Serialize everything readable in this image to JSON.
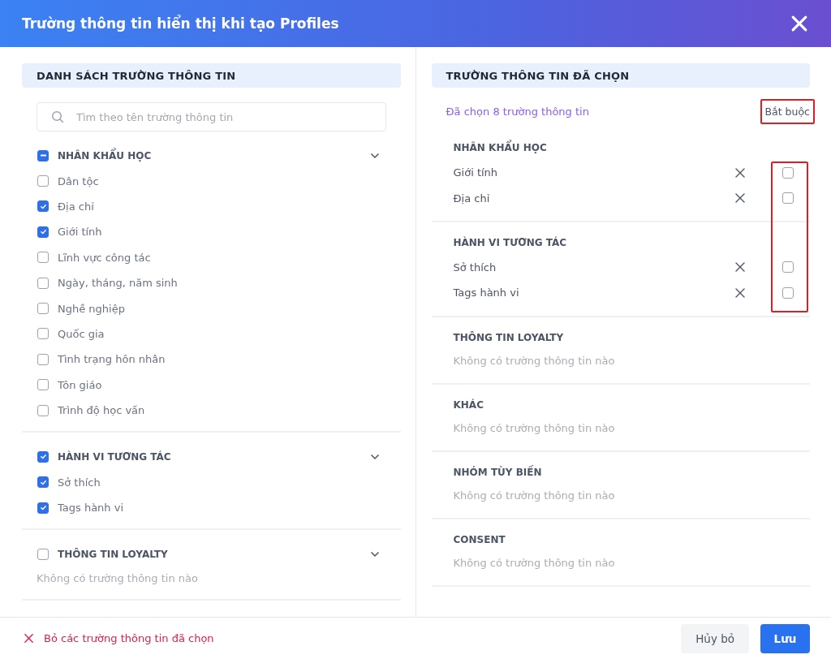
{
  "dialog": {
    "title": "Trường thông tin hiển thị khi tạo Profiles"
  },
  "field_list": {
    "title": "DANH SÁCH TRƯỜNG THÔNG TIN",
    "search": {
      "placeholder": "Tìm theo tên trường thông tin"
    },
    "groups": [
      {
        "name": "NHÂN KHẨU HỌC",
        "kind": "partial",
        "fields": [
          {
            "label": "Dân tộc",
            "checked": false
          },
          {
            "label": "Địa chỉ",
            "checked": true
          },
          {
            "label": "Giới tính",
            "checked": true
          },
          {
            "label": "Lĩnh vực công tác",
            "checked": false
          },
          {
            "label": "Ngày, tháng, năm sinh",
            "checked": false
          },
          {
            "label": "Nghề nghiệp",
            "checked": false
          },
          {
            "label": "Quốc gia",
            "checked": false
          },
          {
            "label": "Tình trạng hôn nhân",
            "checked": false
          },
          {
            "label": "Tôn giáo",
            "checked": false
          },
          {
            "label": "Trình độ học vấn",
            "checked": false
          }
        ]
      },
      {
        "name": "HÀNH VI TƯƠNG TÁC",
        "kind": "checked",
        "fields": [
          {
            "label": "Sở thích",
            "checked": true
          },
          {
            "label": "Tags hành vi",
            "checked": true
          }
        ]
      },
      {
        "name": "THÔNG TIN LOYALTY",
        "kind": "unchecked",
        "empty_text": "Không có trường thông tin nào"
      }
    ]
  },
  "selected": {
    "title": "TRƯỜNG THÔNG TIN ĐÃ CHỌN",
    "summary": "Đã chọn 8 trường thông tin",
    "required_label": {
      "text": "Bắt buộc",
      "highlighted": true
    },
    "required_column_highlighted": true,
    "groups": [
      {
        "name": "NHÂN KHẨU HỌC",
        "fields": [
          {
            "label": "Giới tính",
            "required": false
          },
          {
            "label": "Địa chỉ",
            "required": false
          }
        ]
      },
      {
        "name": "HÀNH VI TƯƠNG TÁC",
        "fields": [
          {
            "label": "Sở thích",
            "required": false
          },
          {
            "label": "Tags hành vi",
            "required": false
          }
        ]
      },
      {
        "name": "THÔNG TIN LOYALTY",
        "empty_text": "Không có trường thông tin nào"
      },
      {
        "name": "KHÁC",
        "empty_text": "Không có trường thông tin nào"
      },
      {
        "name": "NHÓM TÙY BIẾN",
        "empty_text": "Không có trường thông tin nào"
      },
      {
        "name": "CONSENT",
        "empty_text": "Không có trường thông tin nào"
      }
    ]
  },
  "footer": {
    "clear_link": "Bỏ các trường thông tin đã chọn",
    "cancel": "Hủy bỏ",
    "save": "Lưu"
  }
}
